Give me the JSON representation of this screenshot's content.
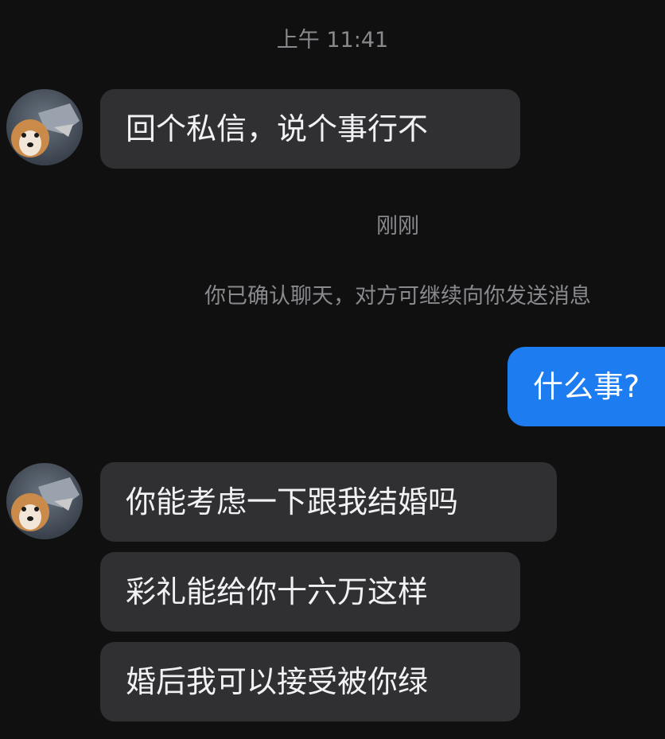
{
  "status": {
    "time_label": "上午 11:41",
    "recent_label": "刚刚"
  },
  "system_notice": "你已确认聊天，对方可继续向你发送消息",
  "messages": [
    {
      "direction": "incoming",
      "text": "回个私信，说个事行不"
    },
    {
      "direction": "outgoing",
      "text": "什么事?"
    },
    {
      "direction": "incoming",
      "text": "你能考虑一下跟我结婚吗"
    },
    {
      "direction": "incoming",
      "text": "彩礼能给你十六万这样"
    },
    {
      "direction": "incoming",
      "text": "婚后我可以接受被你绿"
    }
  ],
  "colors": {
    "background": "#101011",
    "incoming_bubble": "#303033",
    "outgoing_bubble": "#1e7cf1",
    "meta_text": "#8a8a8e"
  }
}
